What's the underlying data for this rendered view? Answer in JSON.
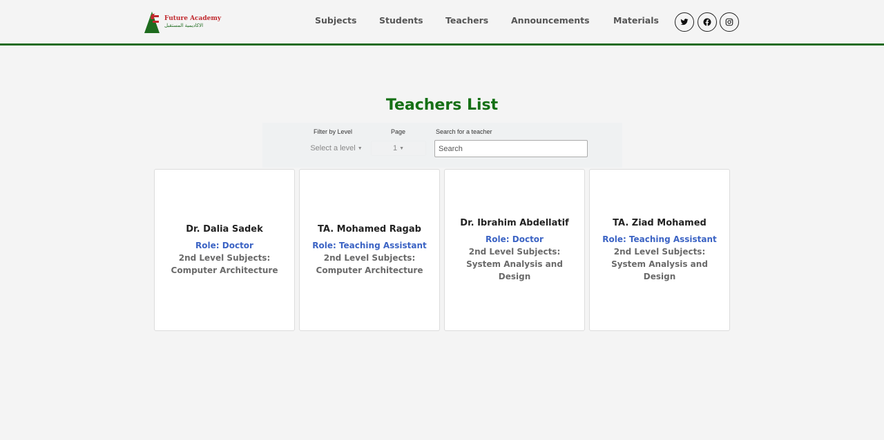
{
  "brand": {
    "name_en": "Future Academy",
    "name_ar": "الاكاديمية المستقبل",
    "colors": {
      "red": "#c0282d",
      "green": "#1e6b1e"
    }
  },
  "nav": {
    "links": [
      {
        "label": "Subjects"
      },
      {
        "label": "Students"
      },
      {
        "label": "Teachers"
      },
      {
        "label": "Announcements"
      },
      {
        "label": "Materials"
      }
    ],
    "social": [
      {
        "icon": "twitter-icon"
      },
      {
        "icon": "facebook-icon"
      },
      {
        "icon": "instagram-icon"
      }
    ]
  },
  "main": {
    "title": "Teachers List",
    "title_color": "#157015",
    "filters": {
      "level_label": "Filter by Level",
      "level_value": "Select a level",
      "page_label": "Page",
      "page_value": "1",
      "search_label": "Search for a teacher",
      "search_placeholder": "Search"
    },
    "teachers": [
      {
        "name": "Dr. Dalia Sadek",
        "role": "Role: Doctor",
        "subjects": "2nd Level Subjects: Computer Architecture"
      },
      {
        "name": "TA. Mohamed Ragab",
        "role": "Role: Teaching Assistant",
        "subjects": "2nd Level Subjects: Computer Architecture"
      },
      {
        "name": "Dr. Ibrahim Abdellatif",
        "role": "Role: Doctor",
        "subjects": "2nd Level Subjects: System Analysis and Design"
      },
      {
        "name": "TA. Ziad Mohamed",
        "role": "Role: Teaching Assistant",
        "subjects": "2nd Level Subjects: System Analysis and Design"
      }
    ]
  }
}
